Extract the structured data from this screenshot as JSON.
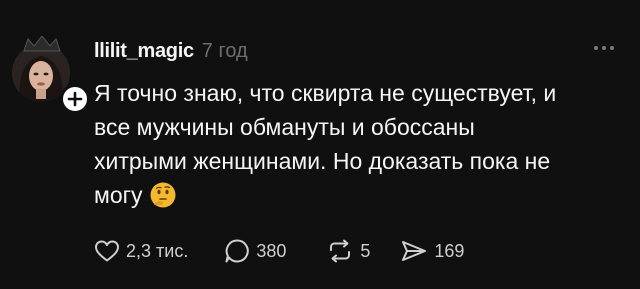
{
  "post": {
    "username": "llilit_magic",
    "time": "7 год",
    "text_lines": [
      "Я точно знаю, что сквирта не существует, и",
      "все мужчины обмануты и обоссаны",
      "хитрыми женщинами. Но доказать пока не",
      "могу"
    ],
    "emoji": "thinking-face-emoji",
    "stats": {
      "likes": "2,3 тис.",
      "replies": "380",
      "reposts": "5",
      "shares": "169"
    }
  },
  "icons": {
    "like": "heart-icon",
    "reply": "comment-bubble-icon",
    "repost": "repost-icon",
    "share": "send-icon",
    "more": "more-dots-icon",
    "follow": "plus-icon"
  },
  "colors": {
    "background": "#101010",
    "text": "#f3f5f7",
    "muted": "#6e6e6e",
    "emoji": "#f5b82e"
  }
}
